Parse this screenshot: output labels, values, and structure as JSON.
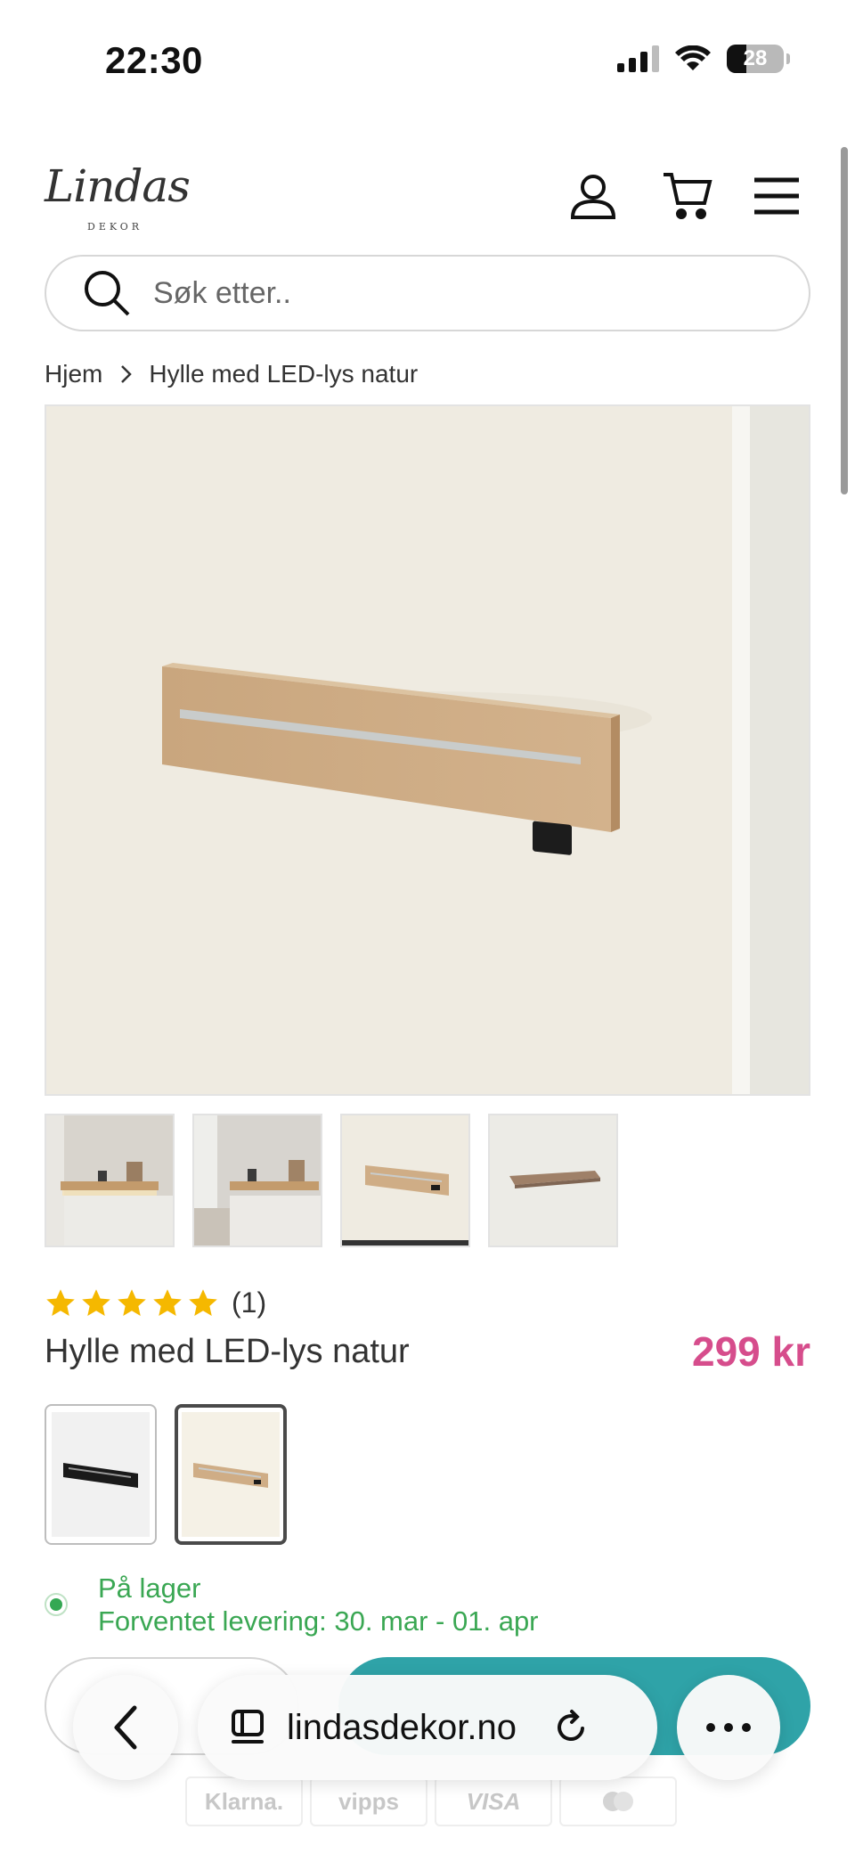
{
  "status_bar": {
    "time": "22:30",
    "battery": "28"
  },
  "header": {
    "logo_text": "Lindas",
    "logo_subtext": "DEKOR"
  },
  "search": {
    "placeholder": "Søk etter.."
  },
  "breadcrumb": {
    "home": "Hjem",
    "current": "Hylle med LED-lys natur"
  },
  "product": {
    "rating_stars": 5,
    "rating_count": "(1)",
    "title": "Hylle med LED-lys natur",
    "price": "299 kr",
    "stock_status": "På lager",
    "delivery": "Forventet levering: 30. mar - 01. apr"
  },
  "colors": {
    "price": "#d64d8c",
    "stock": "#3aa753",
    "cart_button": "#2fa3a8"
  },
  "payments": [
    "Klarna.",
    "vipps",
    "VISA",
    ""
  ],
  "browser": {
    "url": "lindasdekor.no"
  }
}
